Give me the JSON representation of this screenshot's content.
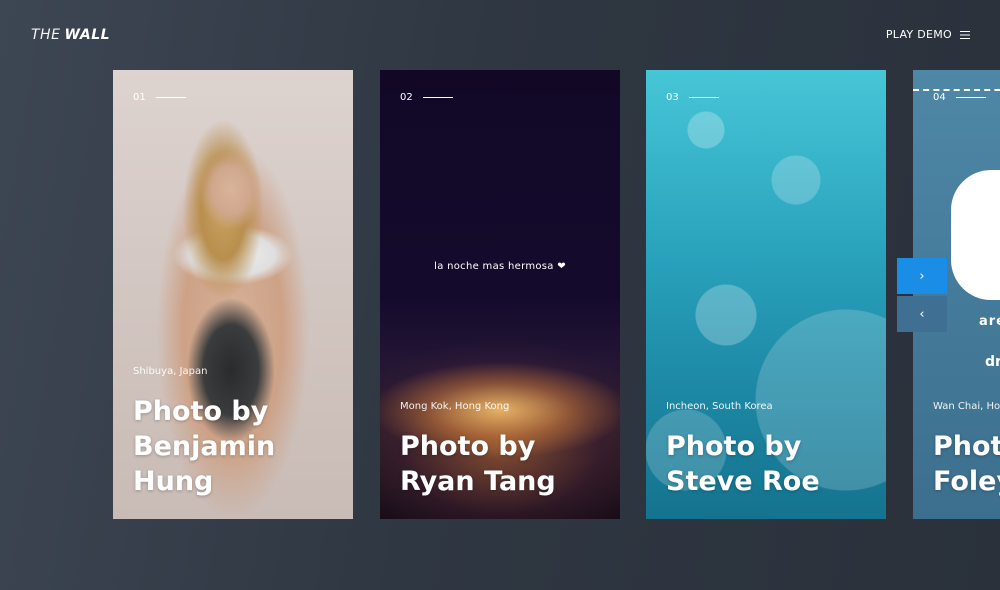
{
  "header": {
    "logo_the": "THE",
    "logo_wall": "WALL",
    "play_demo": "PLAY DEMO",
    "menu_icon": "hamburger-menu-icon"
  },
  "cards": [
    {
      "number": "01",
      "location": "Shibuya, Japan",
      "title": "Photo by Benjamin Hung",
      "image": "woman-portrait-photo"
    },
    {
      "number": "02",
      "tagline": "la noche mas hermosa ❤",
      "location": "Mong Kok, Hong Kong",
      "title": "Photo by Ryan Tang",
      "image": "city-night-lights-photo"
    },
    {
      "number": "03",
      "location": "Incheon, South Korea",
      "title": "Photo by Steve Roe",
      "image": "underwater-bubbles-photo"
    },
    {
      "number": "04",
      "art_text_1": "are",
      "art_text_2": "dr",
      "location": "Wan Chai, Hon",
      "title": "Photo",
      "title_line2": "Foley",
      "image": "illustration-poster-photo"
    }
  ],
  "navigation": {
    "next_icon": "chevron-right-icon",
    "next_glyph": "›",
    "prev_icon": "chevron-left-icon",
    "prev_glyph": "‹"
  },
  "colors": {
    "background": "#2f3742",
    "next_button": "#1a8ee6",
    "prev_button": "#3f6f93"
  }
}
